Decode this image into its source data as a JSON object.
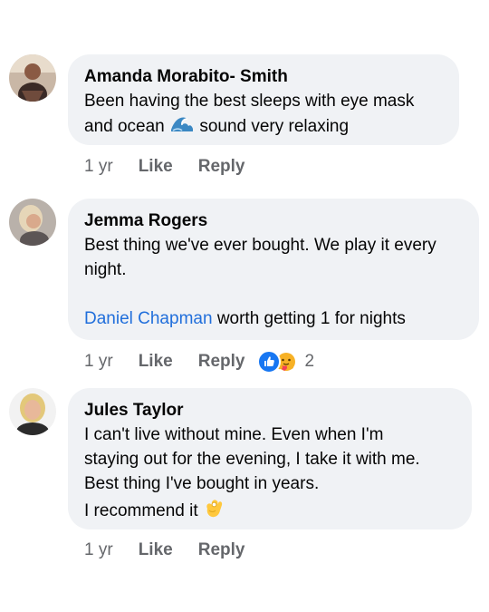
{
  "comments": [
    {
      "author": "Amanda Morabito- Smith",
      "lines": [
        "Been having the best sleeps with eye mask",
        "and ocean",
        "sound very relaxing"
      ],
      "emoji": "wave-emoji",
      "time": "1 yr",
      "like_label": "Like",
      "reply_label": "Reply"
    },
    {
      "author": "Jemma Rogers",
      "lines": [
        "Best thing we've ever bought. We play it every",
        "night."
      ],
      "mention": "Daniel Chapman",
      "mention_text": "worth getting 1 for nights",
      "time": "1 yr",
      "like_label": "Like",
      "reply_label": "Reply",
      "reaction_icons": [
        "like-reaction-icon",
        "care-reaction-icon"
      ],
      "reaction_count": "2"
    },
    {
      "author": "Jules Taylor",
      "lines": [
        "I can't live without mine. Even when I'm",
        "staying out for the evening, I take it with me.",
        "Best thing I've bought in years.",
        "I recommend it"
      ],
      "emoji": "ok-hand-emoji",
      "time": "1 yr",
      "like_label": "Like",
      "reply_label": "Reply"
    }
  ],
  "colors": {
    "bubble": "#f0f2f5",
    "meta_text": "#65676b",
    "mention": "#216fdb",
    "like_blue": "#1877f2"
  }
}
